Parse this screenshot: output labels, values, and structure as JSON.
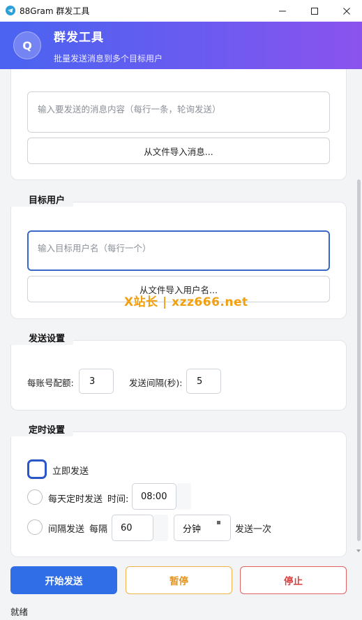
{
  "window": {
    "title": "88Gram 群发工具",
    "minimize_icon": "minimize-icon",
    "maximize_icon": "maximize-icon",
    "close_icon": "close-icon"
  },
  "header": {
    "logo_letter": "Q",
    "title": "群发工具",
    "subtitle": "批量发送消息到多个目标用户"
  },
  "message": {
    "placeholder": "输入要发送的消息内容（每行一条，轮询发送）",
    "import_label": "从文件导入消息..."
  },
  "targets": {
    "section_title": "目标用户",
    "placeholder": "输入目标用户名（每行一个）",
    "import_label": "从文件导入用户名..."
  },
  "send_settings": {
    "section_title": "发送设置",
    "quota_label": "每账号配额:",
    "quota_value": "3",
    "interval_label": "发送间隔(秒):",
    "interval_value": "5"
  },
  "schedule": {
    "section_title": "定时设置",
    "immediate_label": "立即发送",
    "immediate_checked": true,
    "daily_label": "每天定时发送",
    "time_label": "时间:",
    "time_value": "08:00",
    "daily_checked": false,
    "interval_label": "间隔发送",
    "every_label": "每隔",
    "every_value": "60",
    "unit_value": "分钟",
    "suffix_label": "发送一次",
    "interval_checked": false
  },
  "actions": {
    "start_label": "开始发送",
    "pause_label": "暂停",
    "stop_label": "停止"
  },
  "status": {
    "text": "就绪"
  },
  "watermark": {
    "text": "X站长 | xzz666.net"
  },
  "colors": {
    "accent": "#2f6ee6",
    "header_gradient_start": "#4a63f0",
    "header_gradient_end": "#8b53ee",
    "pause": "#e3941a",
    "stop": "#d84040"
  }
}
